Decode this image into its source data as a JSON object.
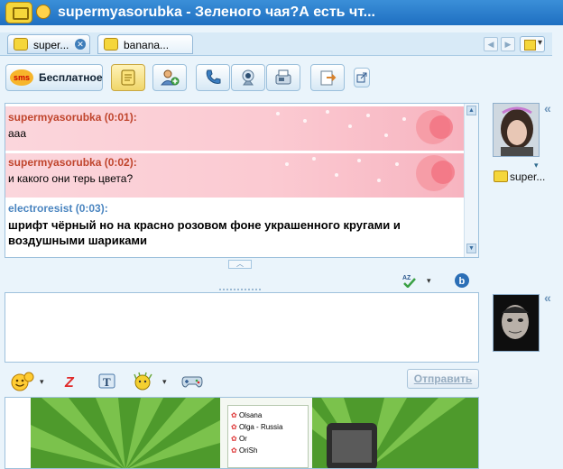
{
  "window": {
    "title": "supermyasorubka - Зеленого чая?А есть чт..."
  },
  "tabs": [
    {
      "label": "super...",
      "active": true
    },
    {
      "label": "banana...",
      "active": false
    }
  ],
  "toolbar": {
    "sms_badge": "sms",
    "sms_label": "Бесплатное"
  },
  "history": {
    "messages": [
      {
        "nick": "supermyasorubka (0:01):",
        "text": "ааа",
        "style": "pink",
        "nick_color": "#c0452d"
      },
      {
        "nick": "supermyasorubka (0:02):",
        "text": "и какого они терь цвета?",
        "style": "pink",
        "nick_color": "#c0452d"
      },
      {
        "nick": "electroresist (0:03):",
        "text_line1": "шрифт чёрный но на красно розовом фоне украшенного кругами и",
        "text_line2": "воздушными шариками",
        "style": "plain",
        "nick_color": "#4a85c0"
      }
    ]
  },
  "contact": {
    "name": "super..."
  },
  "send": {
    "label": "Отправить"
  },
  "ad": {
    "contacts": [
      "Olsana",
      "Olga - Russia",
      "Or",
      "OriSh"
    ]
  },
  "colors": {
    "accent": "#1f6fc1",
    "pink_bg": "#fbc9d1",
    "panel_bg": "#eaf4fb"
  }
}
